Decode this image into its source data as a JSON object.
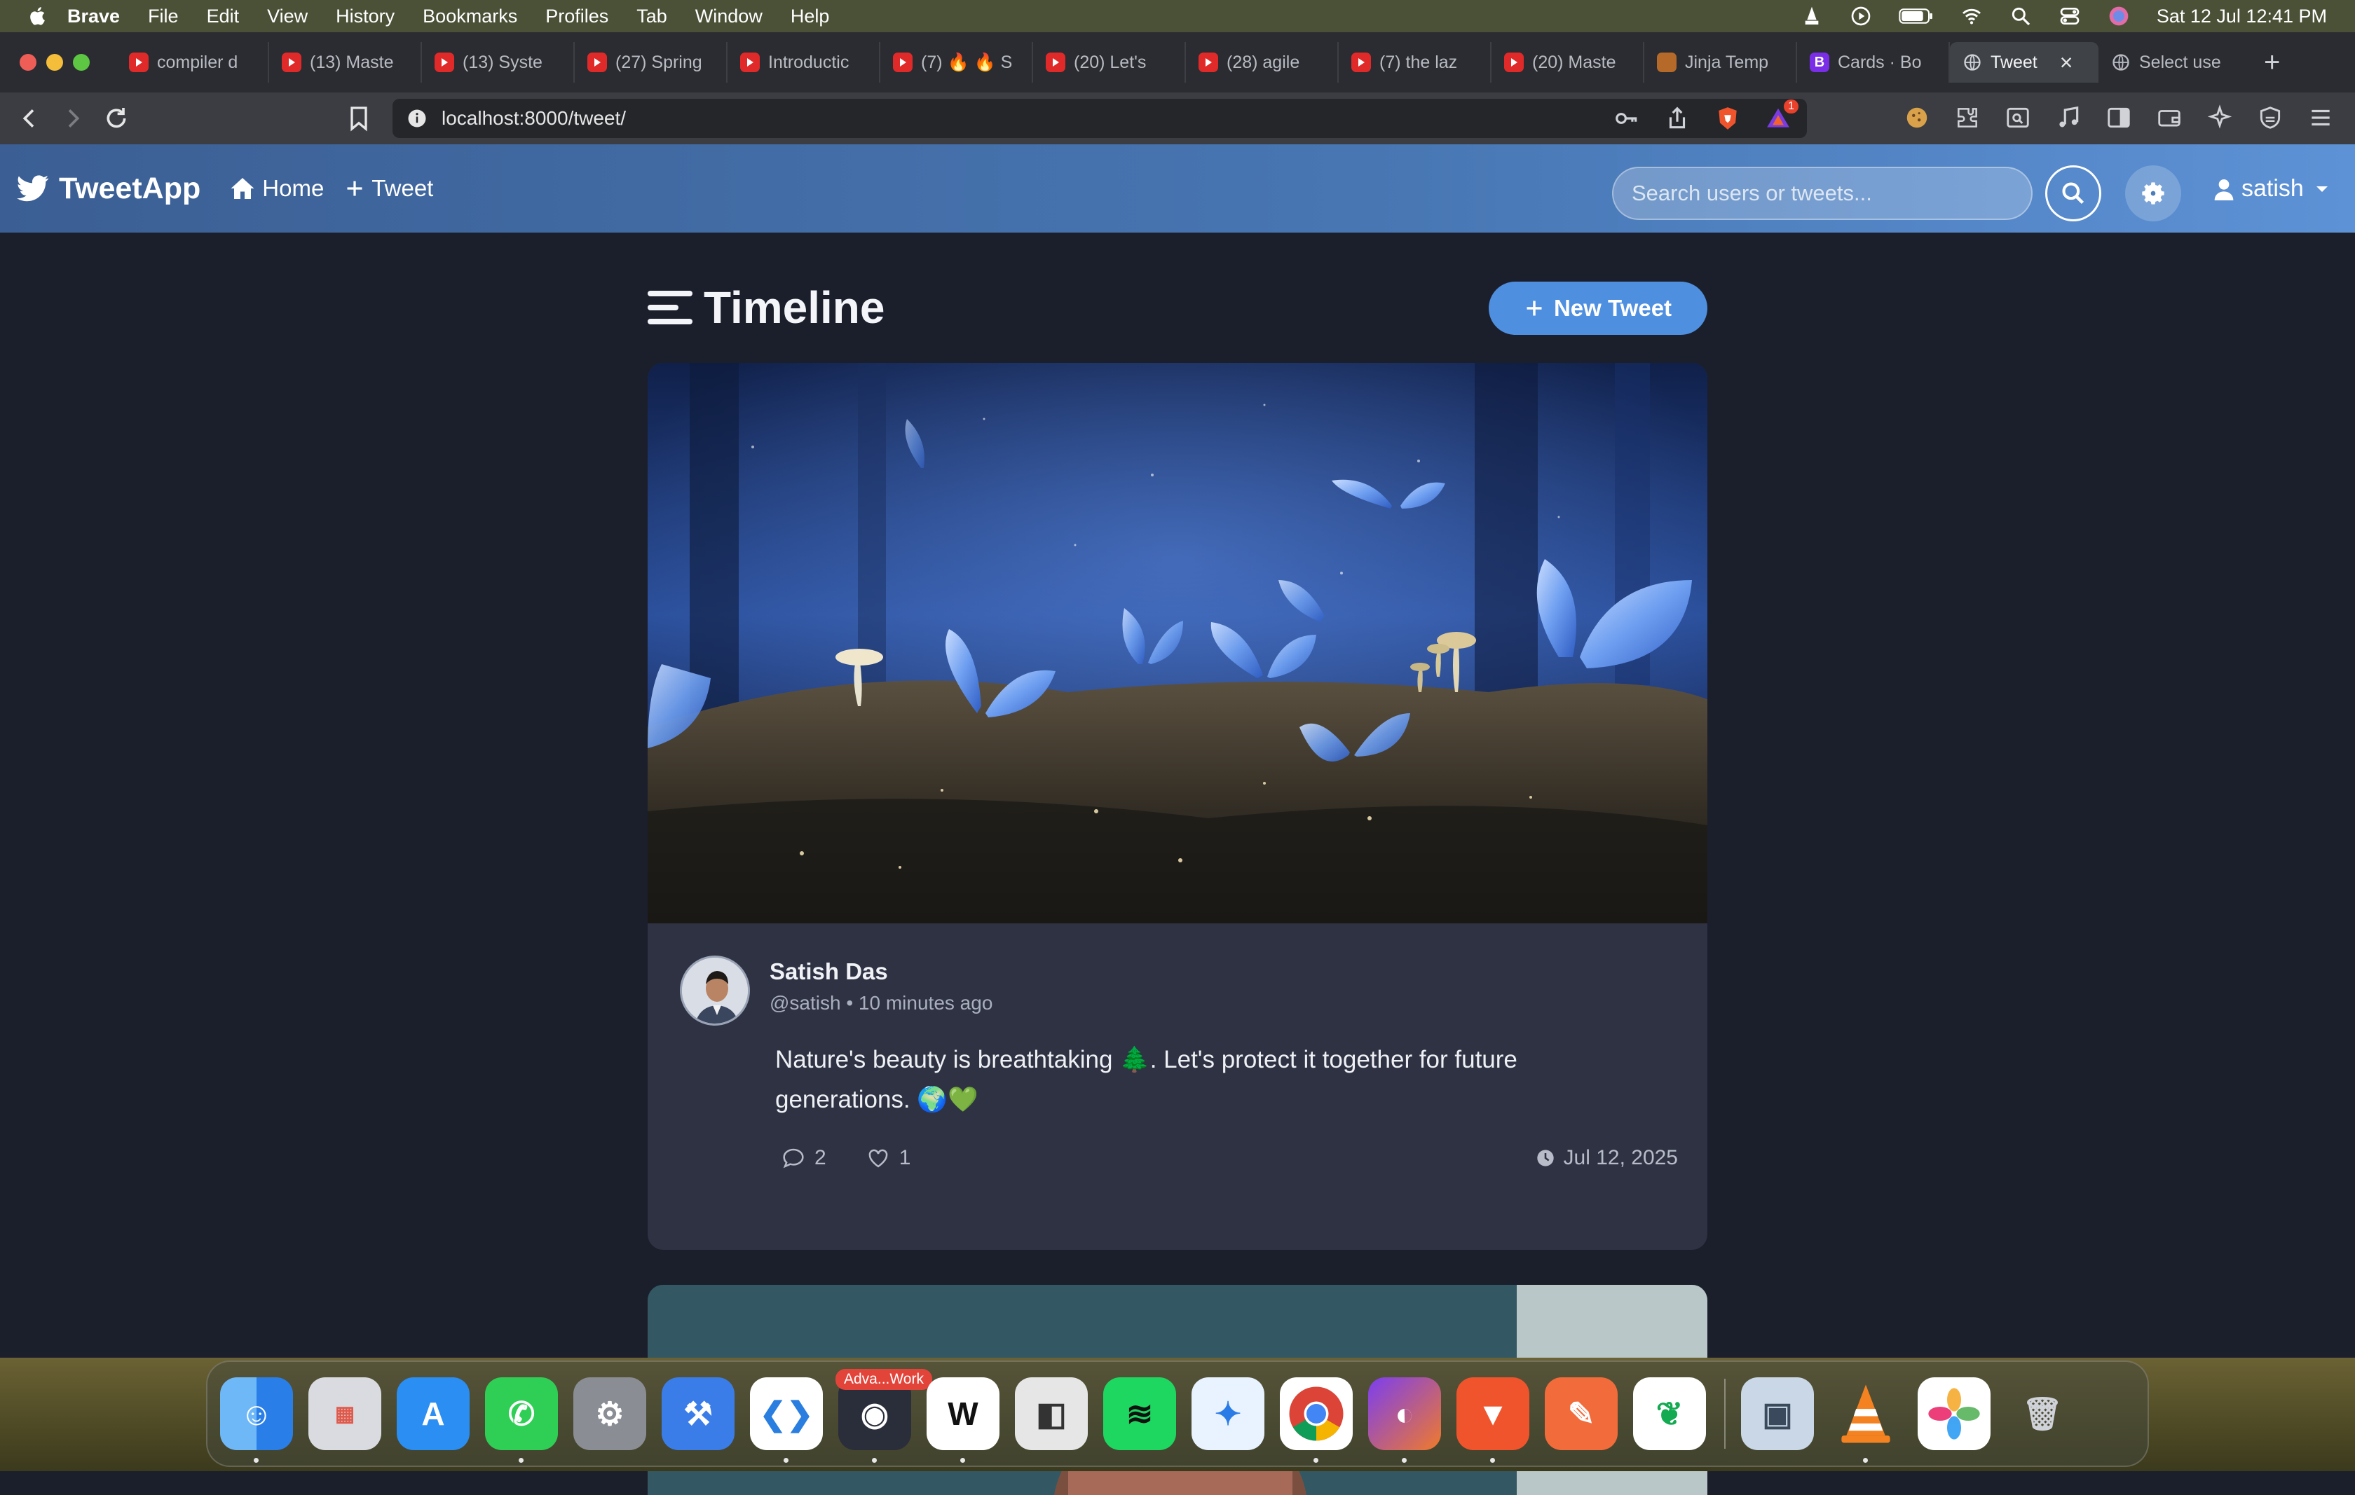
{
  "menubar": {
    "app_name": "Brave",
    "items": [
      "File",
      "Edit",
      "View",
      "History",
      "Bookmarks",
      "Profiles",
      "Tab",
      "Window",
      "Help"
    ],
    "clock": "Sat 12 Jul  12:41 PM"
  },
  "tabs": [
    {
      "title": "compiler d",
      "icon": "youtube-icon"
    },
    {
      "title": "(13) Maste",
      "icon": "youtube-icon"
    },
    {
      "title": "(13) Syste",
      "icon": "youtube-icon"
    },
    {
      "title": "(27) Spring",
      "icon": "youtube-icon"
    },
    {
      "title": "Introductic",
      "icon": "youtube-icon"
    },
    {
      "title": "(7) 🔥 🔥 S",
      "icon": "youtube-icon"
    },
    {
      "title": "(20) Let's",
      "icon": "youtube-icon"
    },
    {
      "title": "(28) agile",
      "icon": "youtube-icon"
    },
    {
      "title": "(7) the laz",
      "icon": "youtube-icon"
    },
    {
      "title": "(20) Maste",
      "icon": "youtube-icon"
    },
    {
      "title": "Jinja Temp",
      "icon": "jinja-icon"
    },
    {
      "title": "Cards · Bo",
      "icon": "bootstrap-icon"
    },
    {
      "title": "Tweet",
      "icon": "globe-icon",
      "active": true
    },
    {
      "title": "Select use",
      "icon": "globe-icon"
    }
  ],
  "toolbar": {
    "url": "localhost:8000/tweet/",
    "shield_badge": "1"
  },
  "app": {
    "brand": "TweetApp",
    "nav_home": "Home",
    "nav_tweet": "Tweet",
    "search_placeholder": "Search users or tweets...",
    "username": "satish"
  },
  "timeline": {
    "title": "Timeline",
    "new_tweet_label": "New Tweet",
    "tweet": {
      "author_name": "Satish Das",
      "meta": "@satish • 10 minutes ago",
      "text": "Nature's beauty is breathtaking 🌲. Let's protect it together for future generations. 🌍💚",
      "comments": "2",
      "likes": "1",
      "date": "Jul 12, 2025"
    }
  },
  "dock": {
    "badge": "Adva...Work",
    "apps": [
      "finder",
      "launchpad",
      "app-store",
      "whatsapp",
      "system-settings",
      "xcode",
      "vscode",
      "advanced-work",
      "wispr",
      "parallels",
      "spotify",
      "safari",
      "chrome",
      "firefox",
      "brave",
      "postman",
      "mongodb-compass",
      "preview",
      "vlc",
      "photos",
      "trash"
    ]
  },
  "colors": {
    "page_bg": "#1b1f2b",
    "card_bg": "#2e3243",
    "accent": "#4f8fe0",
    "nav_gradient_start": "#3b5f94",
    "nav_gradient_end": "#5d92d6"
  }
}
